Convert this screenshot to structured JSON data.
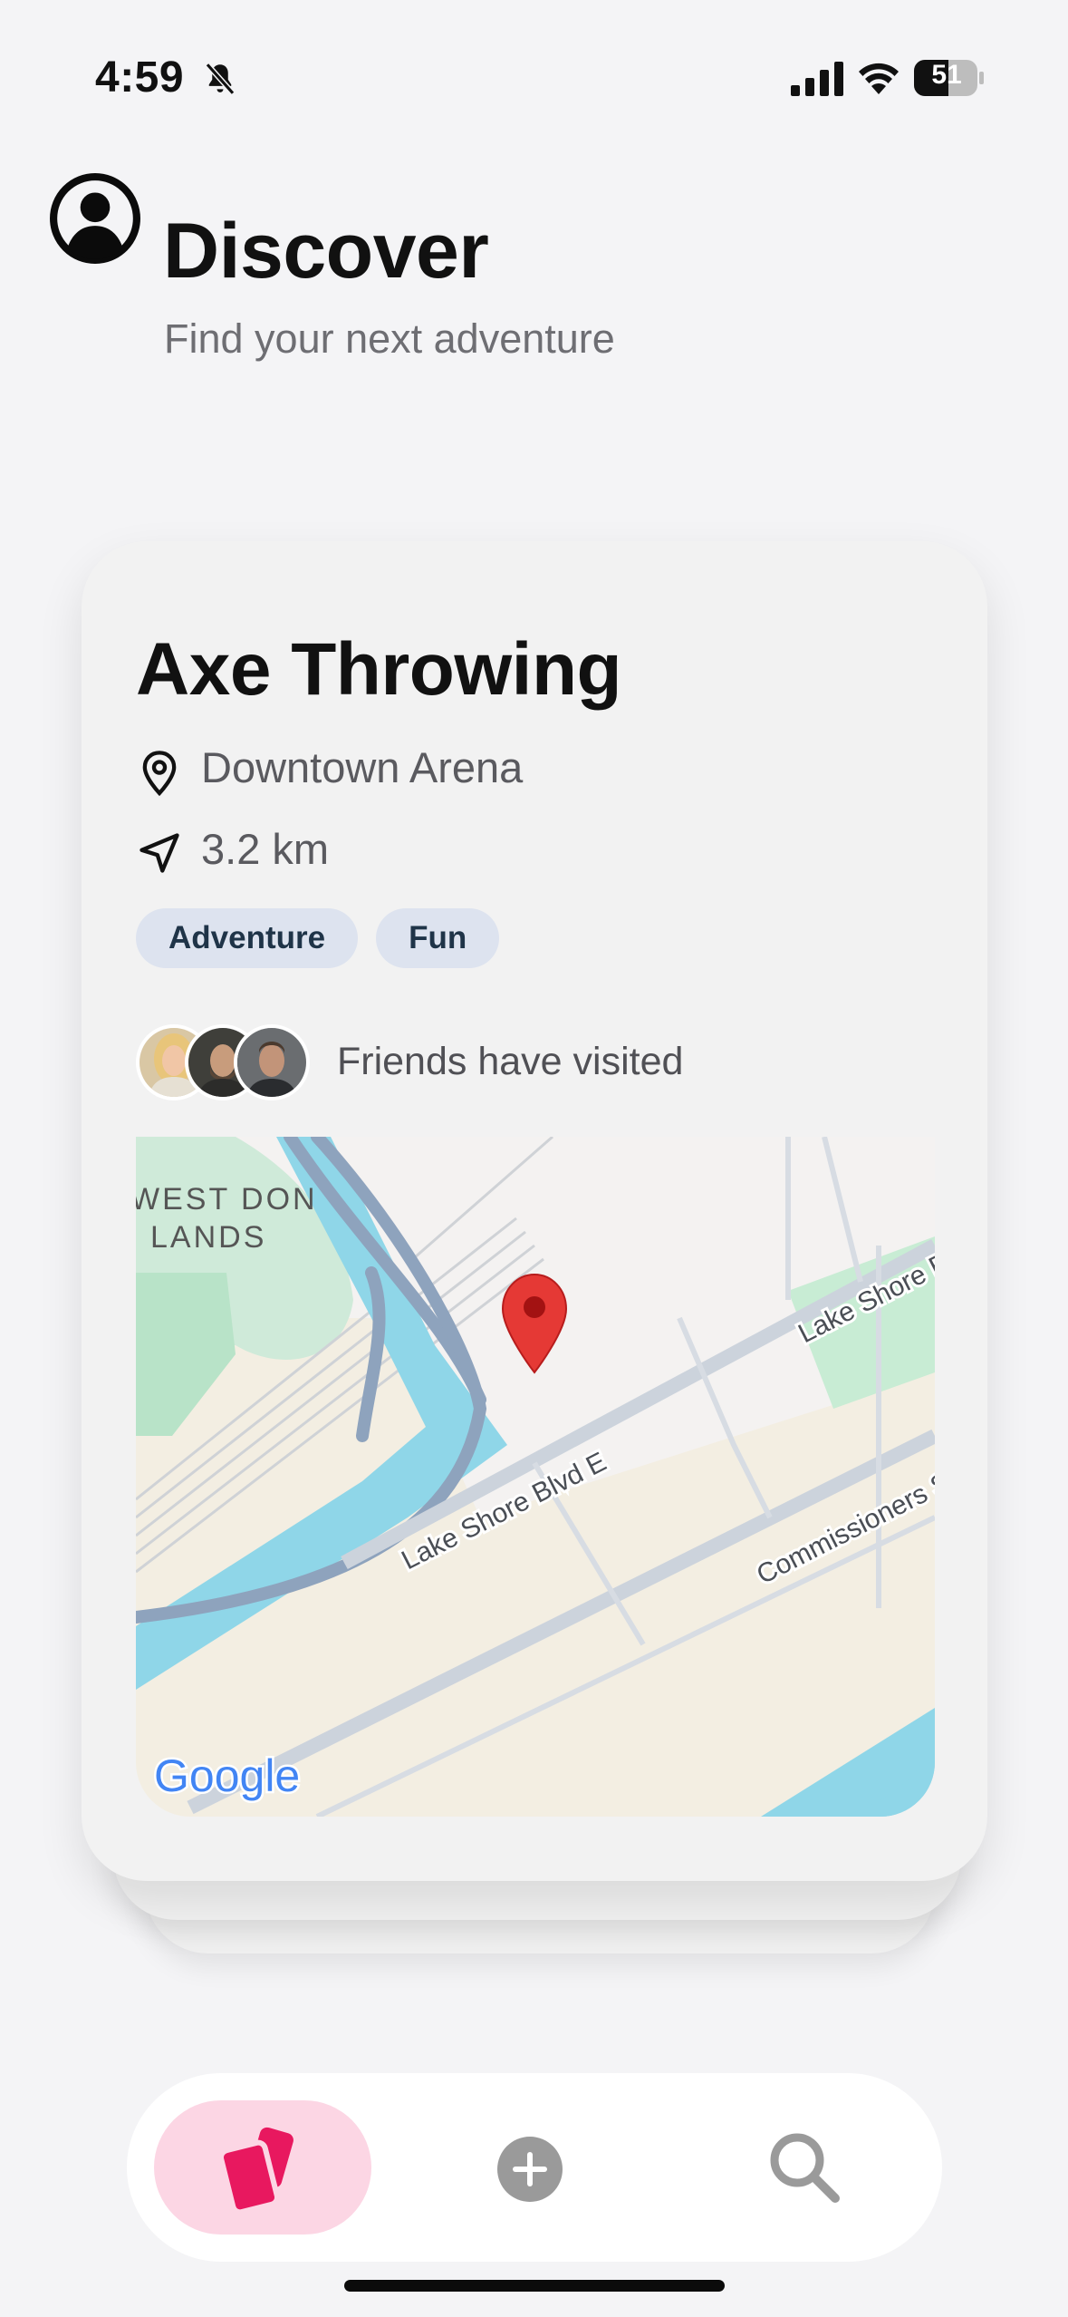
{
  "status_bar": {
    "time": "4:59",
    "battery": "51",
    "icons": [
      "bell-slash-icon",
      "cellular-signal-icon",
      "wifi-icon",
      "battery-icon"
    ]
  },
  "header": {
    "profile_icon": "person-circle-icon",
    "title": "Discover",
    "subtitle": "Find your next adventure"
  },
  "card": {
    "title": "Axe Throwing",
    "location": "Downtown Arena",
    "location_icon": "map-pin-icon",
    "distance": "3.2 km",
    "distance_icon": "navigation-arrow-icon",
    "tags": [
      "Adventure",
      "Fun"
    ],
    "friends_text": "Friends have visited",
    "friend_avatar_count": 3,
    "map": {
      "labels": {
        "area_line1": "WEST DON",
        "area_line2": "LANDS",
        "road_main": "Lake Shore Blvd E",
        "road_right": "Lake Shore Blvd E",
        "road_commissioners": "Commissioners St"
      },
      "attribution": "Google"
    }
  },
  "tabbar": {
    "tabs": [
      {
        "name": "cards",
        "icon": "cards-icon",
        "active": true
      },
      {
        "name": "add",
        "icon": "plus-circle-icon",
        "active": false
      },
      {
        "name": "search",
        "icon": "search-icon",
        "active": false
      }
    ],
    "colors": {
      "active_bg": "#fcd6e4",
      "active_icon": "#e8185f",
      "inactive_icon": "#9a9a9a"
    }
  }
}
